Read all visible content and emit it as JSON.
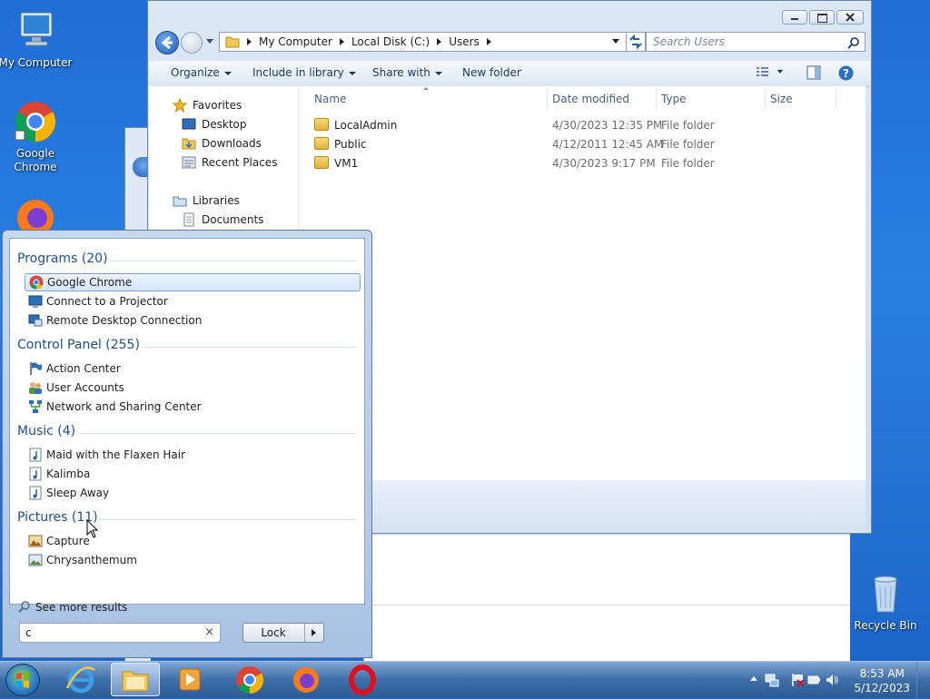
{
  "desktop": {
    "icons": [
      {
        "label": "My Computer"
      },
      {
        "label": "Google Chrome"
      },
      {
        "label": "Recycle Bin"
      }
    ]
  },
  "explorer": {
    "breadcrumbs": [
      "My Computer",
      "Local Disk (C:)",
      "Users"
    ],
    "search_placeholder": "Search Users",
    "toolbar": {
      "organize": "Organize",
      "include": "Include in library",
      "share": "Share with",
      "new_folder": "New folder"
    },
    "nav": {
      "favorites": "Favorites",
      "desktop": "Desktop",
      "downloads": "Downloads",
      "recent": "Recent Places",
      "libraries": "Libraries",
      "documents": "Documents"
    },
    "columns": {
      "name": "Name",
      "date": "Date modified",
      "type": "Type",
      "size": "Size"
    },
    "rows": [
      {
        "name": "LocalAdmin",
        "date": "4/30/2023 12:35 PM",
        "type": "File folder"
      },
      {
        "name": "Public",
        "date": "4/12/2011 12:45 AM",
        "type": "File folder"
      },
      {
        "name": "VM1",
        "date": "4/30/2023 9:17 PM",
        "type": "File folder"
      }
    ]
  },
  "startmenu": {
    "groups": {
      "programs": "Programs (20)",
      "control": "Control Panel (255)",
      "music": "Music (4)",
      "pictures": "Pictures (11)"
    },
    "programs": [
      "Google Chrome",
      "Connect to a Projector",
      "Remote Desktop Connection"
    ],
    "control": [
      "Action Center",
      "User Accounts",
      "Network and Sharing Center"
    ],
    "music": [
      "Maid with the Flaxen Hair",
      "Kalimba",
      "Sleep Away"
    ],
    "pictures": [
      "Capture",
      "Chrysanthemum"
    ],
    "see_more": "See more results",
    "search_value": "c",
    "clear_glyph": "×",
    "lock_label": "Lock"
  },
  "taskbar": {
    "time": "8:53 AM",
    "date": "5/12/2023"
  }
}
